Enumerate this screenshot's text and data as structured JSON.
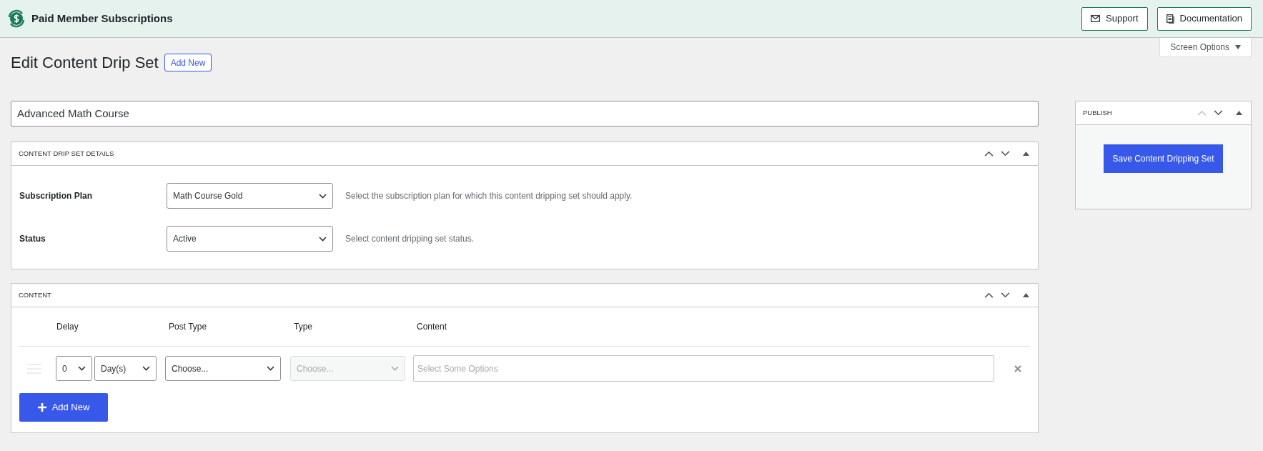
{
  "header": {
    "title": "Paid Member Subscriptions",
    "buttons": [
      {
        "kind": "mail",
        "label": "Support"
      },
      {
        "kind": "doc",
        "label": "Documentation"
      }
    ]
  },
  "screen_options": "Screen Options",
  "page": {
    "title": "Edit Content Drip Set",
    "add_new": "Add New"
  },
  "title_field": {
    "value": "Advanced Math Course"
  },
  "details": {
    "title": "CONTENT DRIP SET DETAILS",
    "up_disabled": false,
    "fields": [
      {
        "label": "Subscription Plan",
        "value": "Math Course Gold",
        "description": "Select the subscription plan for which this content dripping set should apply."
      },
      {
        "label": "Status",
        "value": "Active",
        "description": "Select content dripping set status."
      }
    ]
  },
  "content": {
    "title": "CONTENT",
    "up_disabled": false,
    "columns": [
      "Delay",
      "Post Type",
      "Type",
      "Content"
    ],
    "rows": [
      {
        "delay": "0",
        "unit": "Day(s)",
        "post_type": "Choose...",
        "type": {
          "value": "Choose...",
          "disabled": true
        },
        "content_placeholder": "Select Some Options"
      }
    ],
    "add_new": "Add New"
  },
  "publish": {
    "title": "PUBLISH",
    "up_disabled": true,
    "button": "Save Content Dripping Set"
  }
}
